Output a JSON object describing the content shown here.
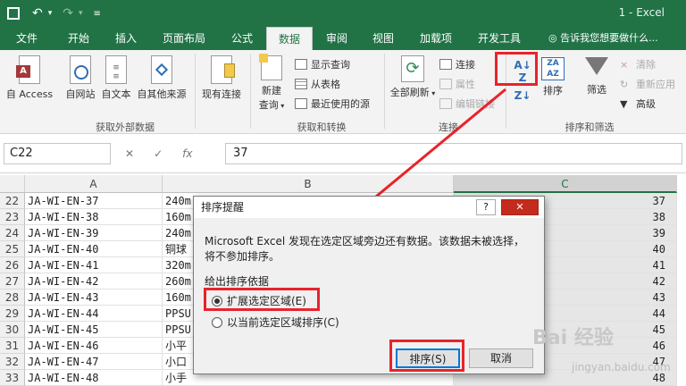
{
  "titlebar": {
    "title": "1 - Excel",
    "save_icon": "save-icon",
    "undo_icon": "undo-icon",
    "redo_icon": "redo-icon",
    "customize_icon": "customize-qat-icon"
  },
  "tabs": [
    "文件",
    "开始",
    "插入",
    "页面布局",
    "公式",
    "数据",
    "审阅",
    "视图",
    "加载项",
    "开发工具"
  ],
  "active_tab": "数据",
  "tell_me": "告诉我您想要做什么...",
  "ribbon": {
    "get_external": {
      "buttons": [
        "自 Access",
        "自网站",
        "自文本",
        "自其他来源"
      ],
      "existing": "现有连接",
      "label": "获取外部数据"
    },
    "transform": {
      "new_query_line1": "新建",
      "new_query_line2": "查询",
      "show_queries": "显示查询",
      "from_table": "从表格",
      "recent_sources": "最近使用的源",
      "label": "获取和转换"
    },
    "connections": {
      "refresh_all": "全部刷新",
      "connections": "连接",
      "properties": "属性",
      "edit_links": "编辑链接",
      "label": "连接"
    },
    "sort_filter": {
      "sort": "排序",
      "filter": "筛选",
      "clear": "清除",
      "reapply": "重新应用",
      "advanced": "高级",
      "label": "排序和筛选"
    }
  },
  "formula_bar": {
    "name_box": "C22",
    "fx": "fx",
    "value": "37"
  },
  "columns": [
    "A",
    "B",
    "C"
  ],
  "rows": [
    {
      "num": "22",
      "a": "JA-WI-EN-37",
      "b": "240m",
      "c": "37"
    },
    {
      "num": "23",
      "a": "JA-WI-EN-38",
      "b": "160m",
      "c": "38"
    },
    {
      "num": "24",
      "a": "JA-WI-EN-39",
      "b": "240m",
      "c": "39"
    },
    {
      "num": "25",
      "a": "JA-WI-EN-40",
      "b": "铜球",
      "c": "40"
    },
    {
      "num": "26",
      "a": "JA-WI-EN-41",
      "b": "320m",
      "c": "41"
    },
    {
      "num": "27",
      "a": "JA-WI-EN-42",
      "b": "260m",
      "c": "42"
    },
    {
      "num": "28",
      "a": "JA-WI-EN-43",
      "b": "160m",
      "c": "43"
    },
    {
      "num": "29",
      "a": "JA-WI-EN-44",
      "b": "PPSU",
      "c": "44"
    },
    {
      "num": "30",
      "a": "JA-WI-EN-45",
      "b": "PPSU",
      "c": "45"
    },
    {
      "num": "31",
      "a": "JA-WI-EN-46",
      "b": "小平",
      "c": "46"
    },
    {
      "num": "32",
      "a": "JA-WI-EN-47",
      "b": "小口",
      "c": "47"
    },
    {
      "num": "33",
      "a": "JA-WI-EN-48",
      "b": "小手",
      "c": "48"
    }
  ],
  "dialog": {
    "title": "排序提醒",
    "help": "?",
    "close": "✕",
    "message": "Microsoft Excel 发现在选定区域旁边还有数据。该数据未被选择，将不参加排序。",
    "section_label": "给出排序依据",
    "option_expand": "扩展选定区域(E)",
    "option_current": "以当前选定区域排序(C)",
    "sort_button": "排序(S)",
    "cancel_button": "取消"
  },
  "watermark": {
    "brand": "Bai 经验",
    "url": "jingyan.baidu.com"
  },
  "colors": {
    "excel_green": "#217346",
    "highlight_red": "#e8232a"
  }
}
